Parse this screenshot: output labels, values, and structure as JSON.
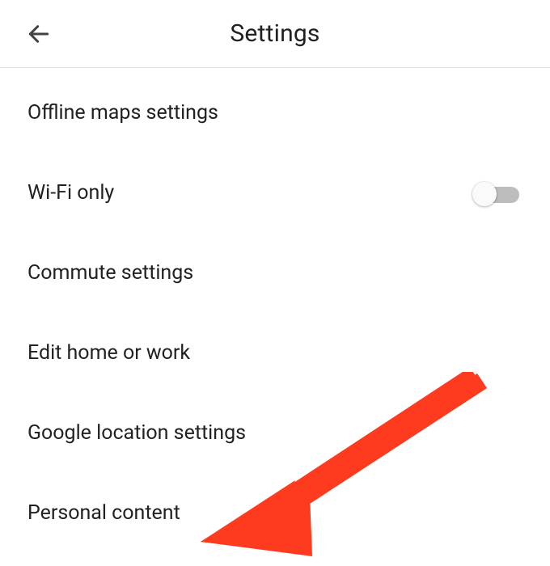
{
  "header": {
    "title": "Settings"
  },
  "items": [
    {
      "label": "Offline maps settings",
      "toggle": false
    },
    {
      "label": "Wi-Fi only",
      "toggle": true,
      "toggle_on": false
    },
    {
      "label": "Commute settings",
      "toggle": false
    },
    {
      "label": "Edit home or work",
      "toggle": false
    },
    {
      "label": "Google location settings",
      "toggle": false
    },
    {
      "label": "Personal content",
      "toggle": false
    }
  ],
  "annotation": {
    "arrow_color": "#ff3b1f"
  }
}
